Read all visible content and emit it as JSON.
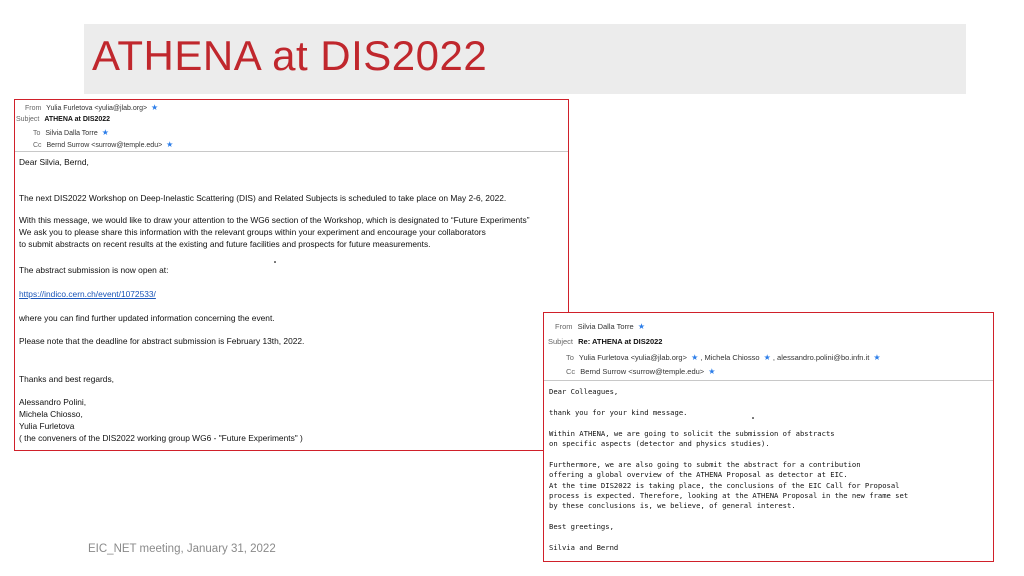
{
  "slide": {
    "title": "ATHENA at DIS2022",
    "footer": "EIC_NET meeting, January 31, 2022"
  },
  "email1": {
    "from_label": "From",
    "from_value": "Yulia Furletova <yulia@jlab.org>",
    "subject_label": "Subject",
    "subject_value": "ATHENA at DIS2022",
    "to_label": "To",
    "to_value": "Silvia Dalla Torre",
    "cc_label": "Cc",
    "cc_value": "Bernd Surrow <surrow@temple.edu>",
    "body": [
      "Dear Silvia, Bernd,",
      "The next DIS2022 Workshop on Deep-Inelastic Scattering (DIS) and Related Subjects is scheduled to take place on May 2-6, 2022.",
      "With this message, we would like to draw your attention to the WG6 section of the Workshop, which is designated to “Future Experiments”",
      "We ask you to please share this information with the relevant  groups within your experiment and encourage your collaborators",
      "to submit abstracts on recent results at the existing and future facilities and prospects for future measurements.",
      "The abstract submission is now open at:",
      "https://indico.cern.ch/event/1072533/",
      "where you can find further updated information concerning the event.",
      "Please note that the deadline for abstract submission is February 13th, 2022.",
      "Thanks and best regards,",
      "Alessandro Polini,",
      "Michela Chiosso,",
      "Yulia Furletova",
      "( the conveners of the DIS2022  working group WG6 - \"Future Experiments\" )"
    ]
  },
  "email2": {
    "from_label": "From",
    "from_value": "Silvia Dalla Torre",
    "subject_label": "Subject",
    "subject_value": "Re: ATHENA at DIS2022",
    "to_label": "To",
    "to_value_1": "Yulia Furletova <yulia@jlab.org>",
    "to_value_2": ", Michela Chiosso",
    "to_value_3": ", alessandro.polini@bo.infn.it",
    "cc_label": "Cc",
    "cc_value": "Bernd Surrow <surrow@temple.edu>",
    "body": [
      "Dear Colleagues,",
      "   thank you for your kind message.",
      "Within ATHENA, we are going to solicit the submission of abstracts",
      "on specific aspects (detector and physics studies).",
      "Furthermore, we are also going to submit the abstract for a contribution",
      "offering a global overview of the ATHENA Proposal as detector at EIC.",
      "At the time DIS2022 is taking place, the conclusions of the EIC Call for Proposal",
      "process is expected. Therefore,  looking at the ATHENA Proposal in the new frame set",
      "by these conclusions is, we believe, of general interest.",
      "Best greetings,",
      "Silvia and Bernd"
    ]
  },
  "icons": {
    "contact_star": "star-icon",
    "star_color": "#2b7de9"
  },
  "colors": {
    "title": "#c0272d",
    "border": "#d0202a",
    "link": "#1a55b8"
  }
}
